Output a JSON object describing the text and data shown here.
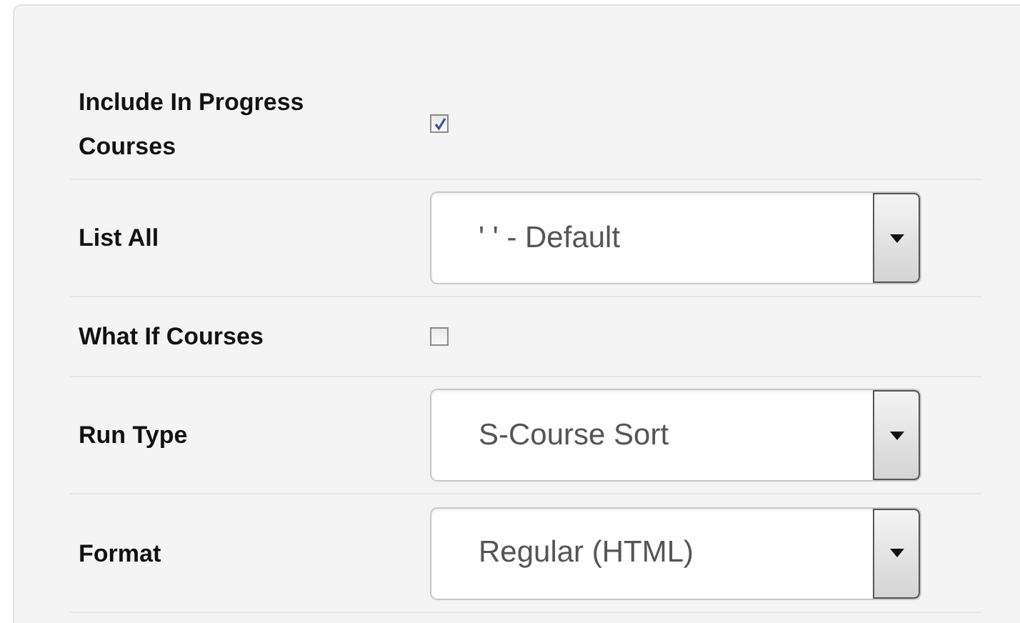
{
  "fields": [
    {
      "kind": "checkbox",
      "label": "Include In Progress Courses",
      "checked": true
    },
    {
      "kind": "select",
      "label": "List All",
      "value": "' ' - Default"
    },
    {
      "kind": "checkbox",
      "label": "What If Courses",
      "checked": false
    },
    {
      "kind": "select",
      "label": "Run Type",
      "value": "S-Course Sort"
    },
    {
      "kind": "select",
      "label": "Format",
      "value": "Regular (HTML)"
    }
  ]
}
